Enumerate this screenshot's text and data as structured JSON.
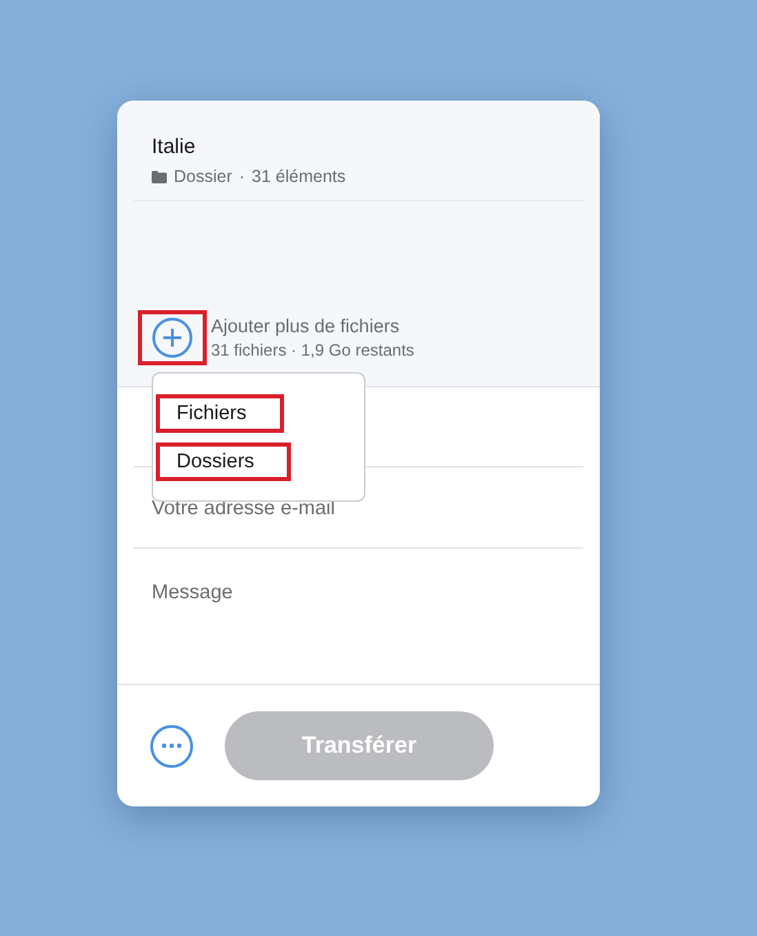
{
  "folder": {
    "title": "Italie",
    "kind_label": "Dossier",
    "separator": "·",
    "count": "31 éléments"
  },
  "add_files": {
    "label": "Ajouter plus de fichiers",
    "details": "31 fichiers · 1,9 Go restants",
    "highlighted": true
  },
  "menu": {
    "items": [
      {
        "label": "Fichiers",
        "highlighted": true
      },
      {
        "label": "Dossiers",
        "highlighted": true
      }
    ]
  },
  "email_field": {
    "placeholder": "Votre adresse e-mail"
  },
  "message_field": {
    "placeholder": "Message"
  },
  "transfer_button": {
    "label": "Transférer",
    "disabled": true
  }
}
